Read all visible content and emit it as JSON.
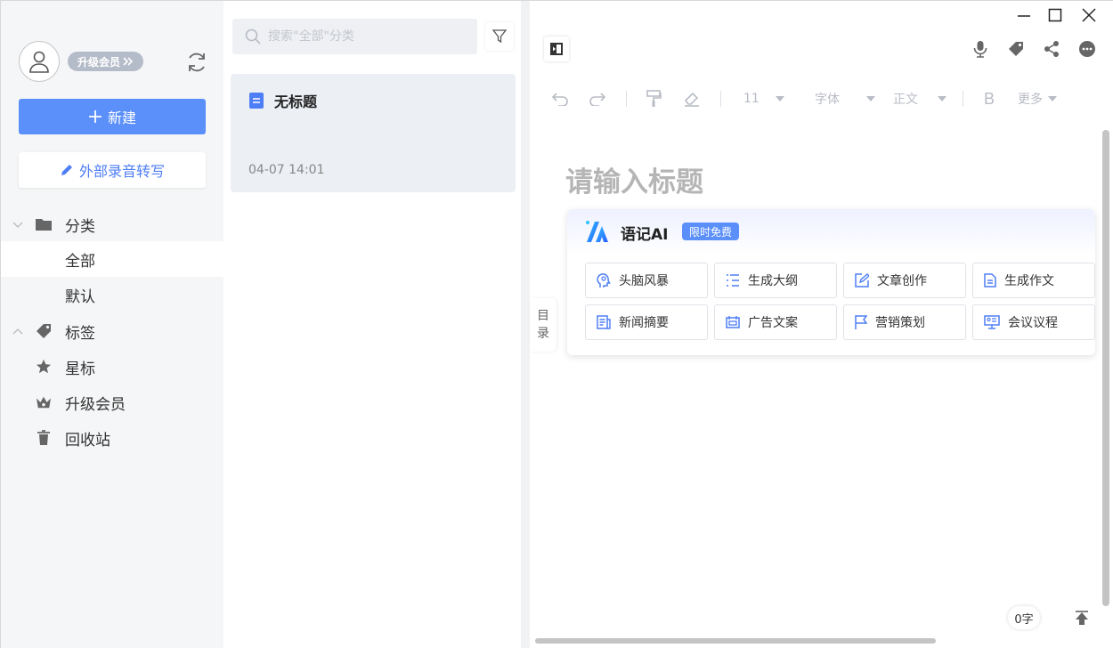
{
  "sidebar": {
    "vip_label": "升级会员",
    "new_label": "新建",
    "transcribe_label": "外部录音转写",
    "nav": {
      "category": "分类",
      "all": "全部",
      "default": "默认",
      "tags": "标签",
      "starred": "星标",
      "upgrade": "升级会员",
      "trash": "回收站"
    }
  },
  "list": {
    "search_placeholder": "搜索\"全部\"分类",
    "notes": [
      {
        "title": "无标题",
        "time": "04-07 14:01"
      }
    ]
  },
  "editor": {
    "toolbar": {
      "font_size": "11",
      "font_family": "字体",
      "paragraph_style": "正文",
      "bold": "B",
      "more": "更多"
    },
    "title_placeholder": "请输入标题",
    "toc_label_1": "目",
    "toc_label_2": "录",
    "word_count": "0字"
  },
  "ai": {
    "name": "语记AI",
    "tag": "限时免费",
    "actions": [
      {
        "label": "头脑风暴",
        "icon": "brain-icon"
      },
      {
        "label": "生成大纲",
        "icon": "outline-icon"
      },
      {
        "label": "文章创作",
        "icon": "edit-doc-icon"
      },
      {
        "label": "生成作文",
        "icon": "essay-icon"
      },
      {
        "label": "新闻摘要",
        "icon": "news-icon"
      },
      {
        "label": "广告文案",
        "icon": "ad-icon"
      },
      {
        "label": "营销策划",
        "icon": "flag-icon"
      },
      {
        "label": "会议议程",
        "icon": "meeting-icon"
      }
    ]
  },
  "colors": {
    "accent": "#5b8ff9",
    "sidebar_bg": "#f5f6f7",
    "card_bg": "#eceff4"
  }
}
